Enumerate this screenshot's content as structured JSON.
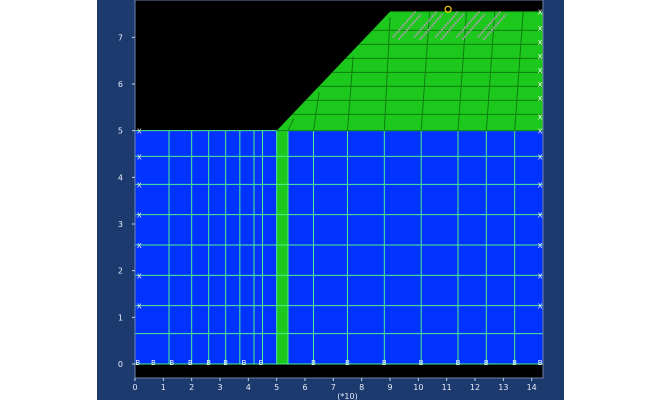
{
  "app": {
    "title": ""
  },
  "axes": {
    "y_ticks": [
      "0",
      "1",
      "2",
      "3",
      "4",
      "5",
      "6",
      "7"
    ],
    "x_ticks": [
      "0",
      "1",
      "2",
      "3",
      "4",
      "5",
      "6",
      "7",
      "8",
      "9",
      "10",
      "11",
      "12",
      "13",
      "14"
    ],
    "x_unit": "(*10)",
    "xlim": [
      0,
      14.4
    ],
    "ylim": [
      -0.3,
      7.8
    ]
  },
  "mesh": {
    "foundation_color": "#0033ff",
    "embankment_color": "#1cc81c",
    "grid_line_color": "#4cf08c",
    "embankment_grid_color": "#0f7d0f",
    "foundation_top_y": 5.0,
    "embankment_top_y": 7.55,
    "slope_toe_x": 5.0,
    "slope_crest_x": 9.0,
    "foundation_columns_x": [
      0.0,
      1.2,
      2.0,
      2.6,
      3.2,
      3.7,
      4.2,
      4.5,
      5.0,
      5.4,
      6.3,
      7.5,
      8.8,
      10.1,
      11.4,
      12.4,
      13.4,
      14.4
    ],
    "foundation_rows_y": [
      0.0,
      0.65,
      1.25,
      1.9,
      2.55,
      3.2,
      3.85,
      4.45,
      5.0
    ],
    "embankment_rows_y": [
      5.0,
      5.35,
      5.65,
      5.95,
      6.25,
      6.55,
      6.85,
      7.15,
      7.55
    ],
    "marker_boundary": "B",
    "marker_fixed": "X",
    "bottom_markers_x": [
      0.1,
      0.65,
      1.3,
      1.95,
      2.6,
      3.2,
      3.85,
      4.45,
      6.3,
      7.5,
      8.8,
      10.1,
      11.4,
      12.4,
      13.4,
      14.3
    ],
    "left_markers_y": [
      1.25,
      1.9,
      2.55,
      3.2,
      3.85,
      4.45,
      5.0
    ],
    "right_markers_y": [
      1.25,
      1.9,
      2.55,
      3.2,
      3.85,
      4.45,
      5.0,
      5.3,
      5.7,
      6.0,
      6.3,
      6.6,
      6.9,
      7.2,
      7.55
    ]
  }
}
